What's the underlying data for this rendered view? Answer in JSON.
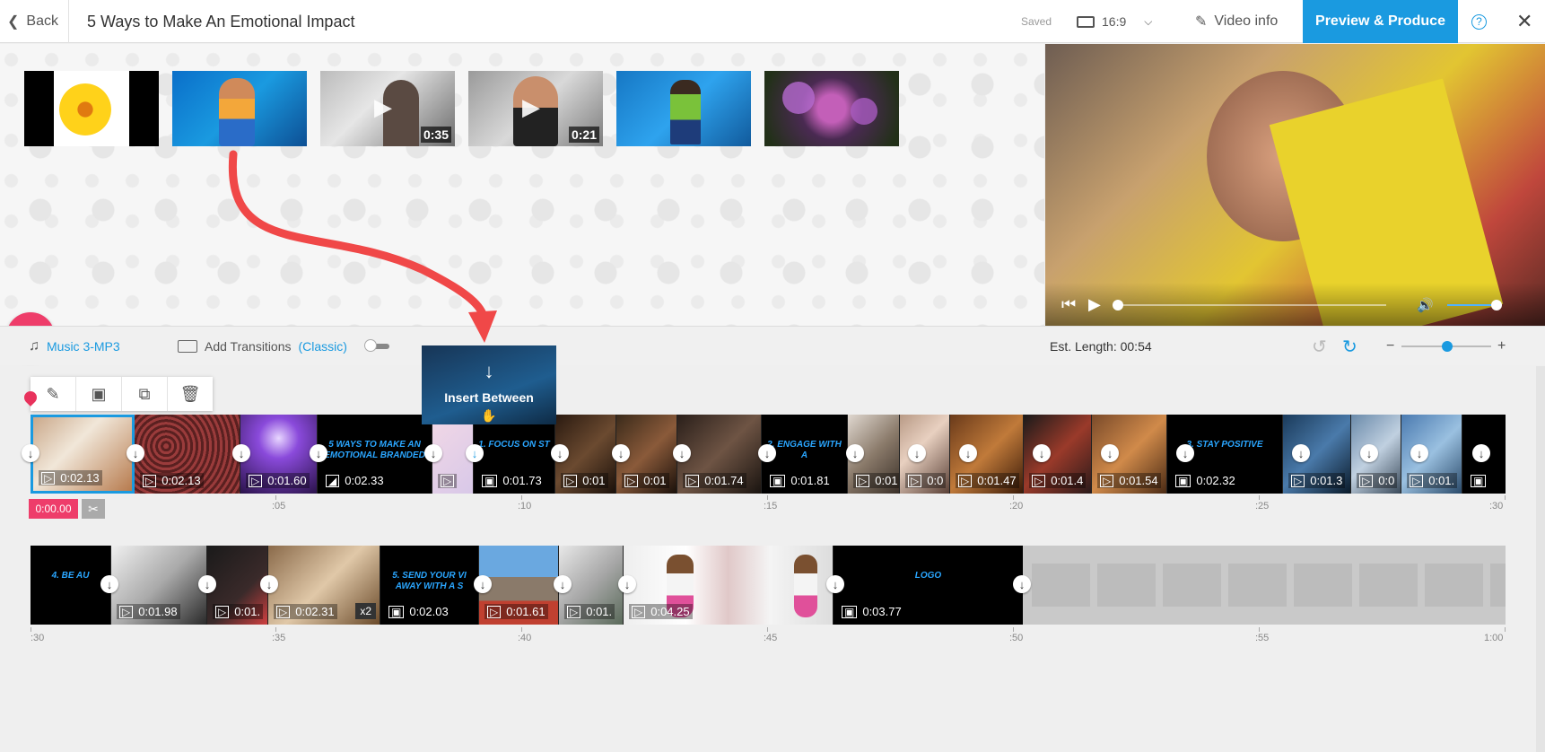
{
  "topbar": {
    "back_label": "Back",
    "project_title": "5 Ways to Make An Emotional Impact",
    "saved_status": "Saved",
    "aspect_ratio": "16:9",
    "video_info_label": "Video info",
    "produce_label": "Preview & Produce"
  },
  "library": {
    "thumbnails": [
      {
        "kind": "image",
        "duration": ""
      },
      {
        "kind": "image",
        "duration": ""
      },
      {
        "kind": "video",
        "duration": "0:35"
      },
      {
        "kind": "video",
        "duration": "0:21"
      },
      {
        "kind": "image",
        "duration": ""
      },
      {
        "kind": "image",
        "duration": ""
      }
    ]
  },
  "toolbar": {
    "music_label": "Music 3-MP3",
    "transitions_label": "Add Transitions",
    "transitions_mode": "(Classic)",
    "est_length": "Est. Length: 00:54"
  },
  "drag_popup": {
    "label": "Insert Between"
  },
  "timeline": {
    "current_time": "0:00.00",
    "track1_clips": [
      {
        "type": "video",
        "duration": "0:02.13",
        "title": ""
      },
      {
        "type": "video",
        "duration": "0:02.13",
        "title": ""
      },
      {
        "type": "video",
        "duration": "0:01.60",
        "title": ""
      },
      {
        "type": "color",
        "duration": "0:02.33",
        "title": "5 WAYS TO MAKE AN EMOTIONAL BRANDED"
      },
      {
        "type": "video",
        "duration": "",
        "title": ""
      },
      {
        "type": "image",
        "duration": "0:01.73",
        "title": "1. FOCUS ON ST"
      },
      {
        "type": "video",
        "duration": "0:01",
        "title": ""
      },
      {
        "type": "video",
        "duration": "0:01",
        "title": ""
      },
      {
        "type": "video",
        "duration": "0:01.74",
        "title": ""
      },
      {
        "type": "image",
        "duration": "0:01.81",
        "title": "2. ENGAGE WITH A"
      },
      {
        "type": "video",
        "duration": "0:01",
        "title": ""
      },
      {
        "type": "video",
        "duration": "0:0",
        "title": ""
      },
      {
        "type": "video",
        "duration": "0:01.47",
        "title": ""
      },
      {
        "type": "video",
        "duration": "0:01.4",
        "title": ""
      },
      {
        "type": "video",
        "duration": "0:01.54",
        "title": ""
      },
      {
        "type": "image",
        "duration": "0:02.32",
        "title": "3. STAY POSITIVE"
      },
      {
        "type": "video",
        "duration": "0:01.3",
        "title": ""
      },
      {
        "type": "video",
        "duration": "0:0",
        "title": ""
      },
      {
        "type": "video",
        "duration": "0:01.",
        "title": ""
      },
      {
        "type": "image",
        "duration": "",
        "title": ""
      }
    ],
    "track2_clips": [
      {
        "type": "image",
        "duration": "",
        "title": "4. BE AU"
      },
      {
        "type": "video",
        "duration": "0:01.98",
        "title": ""
      },
      {
        "type": "video",
        "duration": "0:01.",
        "title": ""
      },
      {
        "type": "video",
        "duration": "0:02.31",
        "title": "",
        "speed": "x2"
      },
      {
        "type": "image",
        "duration": "0:02.03",
        "title": "5. SEND YOUR VI AWAY WITH A S"
      },
      {
        "type": "video",
        "duration": "0:01.61",
        "title": ""
      },
      {
        "type": "video",
        "duration": "0:01.",
        "title": ""
      },
      {
        "type": "video",
        "duration": "0:04.25",
        "title": ""
      },
      {
        "type": "image",
        "duration": "0:03.77",
        "title": "LOGO"
      }
    ],
    "ruler1": [
      ":05",
      ":10",
      ":15",
      ":20",
      ":25",
      ":30"
    ],
    "ruler2": [
      ":30",
      ":35",
      ":40",
      ":45",
      ":50",
      ":55",
      "1:00"
    ]
  },
  "colors": {
    "accent": "#1a9ae0",
    "pink": "#ee3d6a",
    "arrow": "#f04848"
  }
}
